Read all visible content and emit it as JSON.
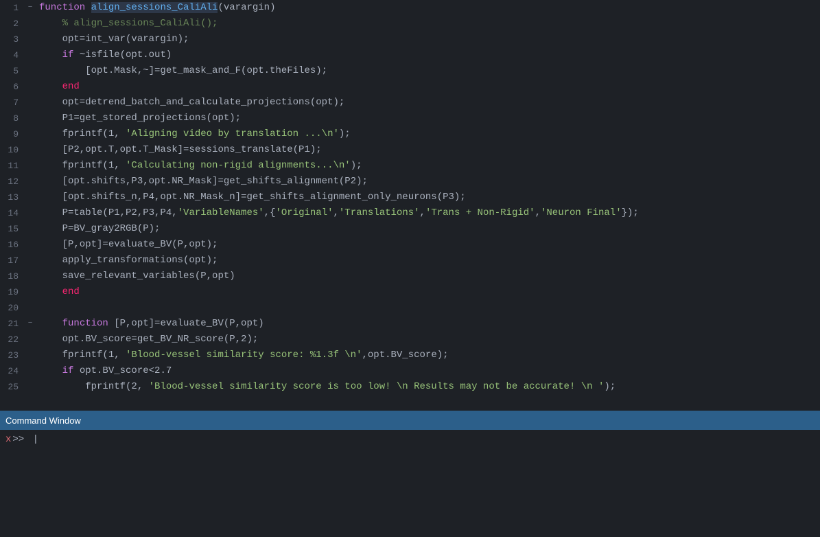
{
  "editor": {
    "lines": [
      {
        "num": 1,
        "fold": "−",
        "tokens": [
          {
            "t": "kw-function",
            "v": "function "
          },
          {
            "t": "highlight-fn",
            "v": "align_sessions_CaliAli"
          },
          {
            "t": "plain",
            "v": "(varargin)"
          }
        ]
      },
      {
        "num": 2,
        "fold": "",
        "tokens": [
          {
            "t": "plain",
            "v": "    "
          },
          {
            "t": "comment",
            "v": "% align_sessions_CaliAli();"
          }
        ]
      },
      {
        "num": 3,
        "fold": "",
        "tokens": [
          {
            "t": "plain",
            "v": "    opt=int_var(varargin);"
          }
        ]
      },
      {
        "num": 4,
        "fold": "",
        "tokens": [
          {
            "t": "plain",
            "v": "    "
          },
          {
            "t": "kw-if",
            "v": "if"
          },
          {
            "t": "plain",
            "v": " ~isfile(opt.out)"
          }
        ]
      },
      {
        "num": 5,
        "fold": "",
        "tokens": [
          {
            "t": "plain",
            "v": "        [opt.Mask,~]=get_mask_and_F(opt.theFiles);"
          }
        ]
      },
      {
        "num": 6,
        "fold": "",
        "tokens": [
          {
            "t": "plain",
            "v": "    "
          },
          {
            "t": "kw-end",
            "v": "end"
          }
        ]
      },
      {
        "num": 7,
        "fold": "",
        "tokens": [
          {
            "t": "plain",
            "v": "    opt=detrend_batch_and_calculate_projections(opt);"
          }
        ]
      },
      {
        "num": 8,
        "fold": "",
        "tokens": [
          {
            "t": "plain",
            "v": "    P1=get_stored_projections(opt);"
          }
        ]
      },
      {
        "num": 9,
        "fold": "",
        "tokens": [
          {
            "t": "plain",
            "v": "    fprintf(1, "
          },
          {
            "t": "string",
            "v": "'Aligning video by translation ...\\n'"
          },
          {
            "t": "plain",
            "v": ");"
          }
        ]
      },
      {
        "num": 10,
        "fold": "",
        "tokens": [
          {
            "t": "plain",
            "v": "    [P2,opt.T,opt.T_Mask]=sessions_translate(P1);"
          }
        ]
      },
      {
        "num": 11,
        "fold": "",
        "tokens": [
          {
            "t": "plain",
            "v": "    fprintf(1, "
          },
          {
            "t": "string",
            "v": "'Calculating non-rigid alignments...\\n'"
          },
          {
            "t": "plain",
            "v": ");"
          }
        ]
      },
      {
        "num": 12,
        "fold": "",
        "tokens": [
          {
            "t": "plain",
            "v": "    [opt.shifts,P3,opt.NR_Mask]=get_shifts_alignment(P2);"
          }
        ]
      },
      {
        "num": 13,
        "fold": "",
        "tokens": [
          {
            "t": "plain",
            "v": "    [opt.shifts_n,P4,opt.NR_Mask_n]=get_shifts_alignment_only_neurons(P3);"
          }
        ]
      },
      {
        "num": 14,
        "fold": "",
        "tokens": [
          {
            "t": "plain",
            "v": "    P=table(P1,P2,P3,P4,"
          },
          {
            "t": "string",
            "v": "'VariableNames'"
          },
          {
            "t": "plain",
            "v": ",{"
          },
          {
            "t": "string",
            "v": "'Original'"
          },
          {
            "t": "plain",
            "v": ","
          },
          {
            "t": "string",
            "v": "'Translations'"
          },
          {
            "t": "plain",
            "v": ","
          },
          {
            "t": "string",
            "v": "'Trans + Non-Rigid'"
          },
          {
            "t": "plain",
            "v": ","
          },
          {
            "t": "string",
            "v": "'Neuron Final'"
          },
          {
            "t": "plain",
            "v": "});"
          }
        ]
      },
      {
        "num": 15,
        "fold": "",
        "tokens": [
          {
            "t": "plain",
            "v": "    P=BV_gray2RGB(P);"
          }
        ]
      },
      {
        "num": 16,
        "fold": "",
        "tokens": [
          {
            "t": "plain",
            "v": "    [P,opt]=evaluate_BV(P,opt);"
          }
        ]
      },
      {
        "num": 17,
        "fold": "",
        "tokens": [
          {
            "t": "plain",
            "v": "    apply_transformations(opt);"
          }
        ]
      },
      {
        "num": 18,
        "fold": "",
        "tokens": [
          {
            "t": "plain",
            "v": "    save_relevant_variables(P,opt)"
          }
        ]
      },
      {
        "num": 19,
        "fold": "",
        "tokens": [
          {
            "t": "plain",
            "v": "    "
          },
          {
            "t": "kw-end",
            "v": "end"
          }
        ]
      },
      {
        "num": 20,
        "fold": "",
        "tokens": []
      },
      {
        "num": 21,
        "fold": "−",
        "tokens": [
          {
            "t": "plain",
            "v": "    "
          },
          {
            "t": "kw-function",
            "v": "function"
          },
          {
            "t": "plain",
            "v": " [P,opt]=evaluate_BV(P,opt)"
          }
        ]
      },
      {
        "num": 22,
        "fold": "",
        "tokens": [
          {
            "t": "plain",
            "v": "    opt.BV_score=get_BV_NR_score(P,2);"
          }
        ]
      },
      {
        "num": 23,
        "fold": "",
        "tokens": [
          {
            "t": "plain",
            "v": "    fprintf(1, "
          },
          {
            "t": "string",
            "v": "'Blood-vessel similarity score: %1.3f \\n'"
          },
          {
            "t": "plain",
            "v": ",opt.BV_score);"
          }
        ]
      },
      {
        "num": 24,
        "fold": "",
        "tokens": [
          {
            "t": "plain",
            "v": "    "
          },
          {
            "t": "kw-if",
            "v": "if"
          },
          {
            "t": "plain",
            "v": " opt.BV_score<2.7"
          }
        ]
      },
      {
        "num": 25,
        "fold": "",
        "tokens": [
          {
            "t": "plain",
            "v": "        fprintf(2, "
          },
          {
            "t": "string",
            "v": "'Blood-vessel similarity score is too low! \\n Results may not be accurate! \\n '"
          },
          {
            "t": "plain",
            "v": ");"
          }
        ]
      }
    ]
  },
  "command_window": {
    "title": "Command Window",
    "prompt_x": "x",
    "prompt_arrows": ">>",
    "cursor_visible": true
  }
}
